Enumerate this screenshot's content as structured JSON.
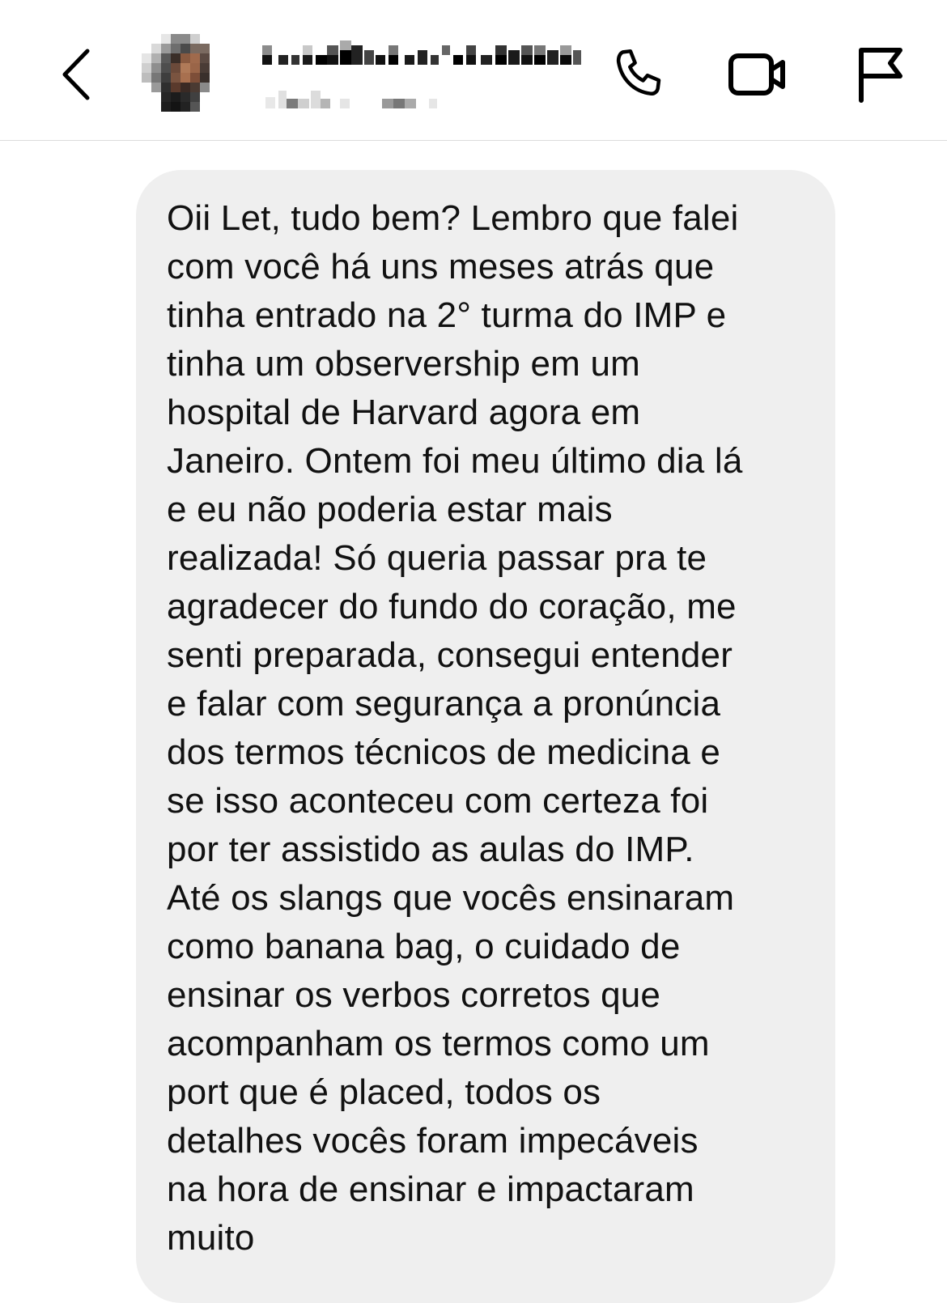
{
  "header": {
    "back_icon": "chevron-left-icon",
    "call_icon": "phone-icon",
    "video_icon": "video-camera-icon",
    "flag_icon": "flag-icon",
    "avatar_state": "pixelated",
    "name_state": "pixelated"
  },
  "message": {
    "text": "Oii Let, tudo bem? Lembro que falei\ncom você há uns meses atrás que\ntinha entrado na 2° turma do IMP e\ntinha um observership em um\nhospital de Harvard agora em\nJaneiro. Ontem foi meu último dia lá\ne eu não poderia estar mais\nrealizada! Só queria passar pra te\nagradecer do fundo do coração, me\nsenti preparada, consegui entender\ne falar com segurança a pronúncia\ndos termos técnicos de medicina e\nse isso aconteceu com certeza foi\npor ter assistido as aulas do IMP.\nAté os slangs que vocês ensinaram\ncomo banana bag, o cuidado de\nensinar os verbos corretos que\nacompanham os termos como um\nport que é placed, todos os\ndetalhes vocês foram impecáveis\nna hora de ensinar e impactaram\nmuito",
    "bubble_color": "#efefef"
  }
}
